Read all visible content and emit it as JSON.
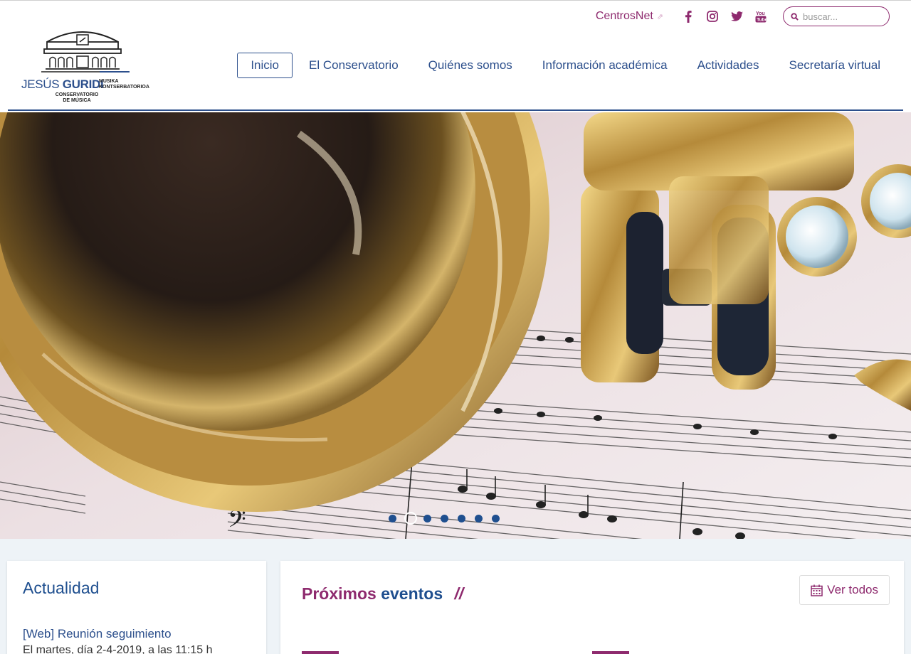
{
  "logo": {
    "name_first": "JESÚS",
    "name_second": "GURIDI",
    "side_line1": "MUSIKA",
    "side_line2": "KONTSERBATORIOA",
    "sub_line1": "CONSERVATORIO",
    "sub_line2": "DE MÚSICA"
  },
  "utility": {
    "centrosnet_label": "CentrosNet",
    "external_glyph": "⇗",
    "social": [
      "facebook-icon",
      "instagram-icon",
      "twitter-icon",
      "youtube-icon"
    ],
    "search_placeholder": "buscar..."
  },
  "nav": {
    "items": [
      {
        "label": "Inicio",
        "active": true
      },
      {
        "label": "El Conservatorio"
      },
      {
        "label": "Quiénes somos"
      },
      {
        "label": "Información académica"
      },
      {
        "label": "Actividades"
      },
      {
        "label": "Secretaría virtual"
      }
    ]
  },
  "carousel": {
    "slide_count": 7,
    "active_index": 1
  },
  "news": {
    "title": "Actualidad",
    "item_title": "[Web] Reunión seguimiento",
    "item_body": "El martes, día 2-4-2019, a las 11:15 h"
  },
  "events": {
    "title_part1": "Próximos",
    "title_part2": "eventos",
    "title_slash": "//",
    "view_all_label": "Ver todos"
  },
  "colors": {
    "primary_blue": "#2c4f8c",
    "accent_purple": "#8e2a6e",
    "content_bg": "#eef3f7"
  }
}
